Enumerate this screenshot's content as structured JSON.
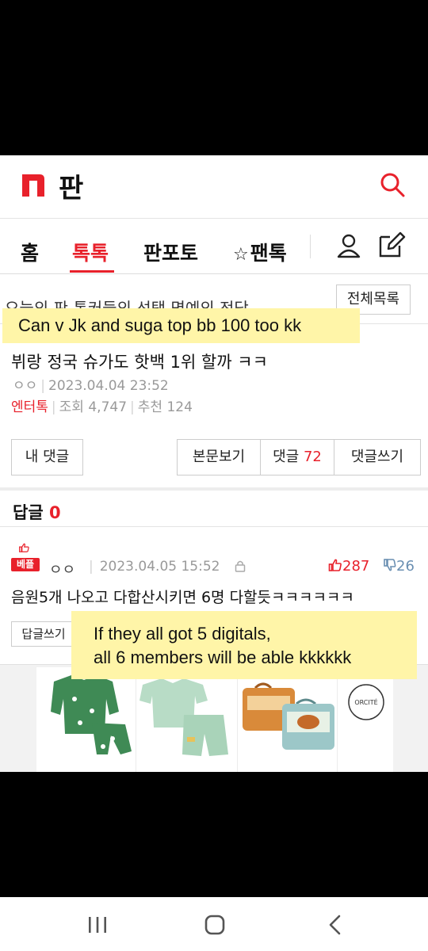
{
  "header": {
    "logo_text": "판",
    "brand_color": "#e8212b"
  },
  "tabs": [
    {
      "label": "홈",
      "active": false
    },
    {
      "label": "톡톡",
      "active": true
    },
    {
      "label": "판포토",
      "active": false
    },
    {
      "label": "팬톡",
      "active": false,
      "prefix": "☆"
    }
  ],
  "ticker": {
    "text": "오늘의 판 톡커들의 선택 명예의 전당",
    "all_list_label": "전체목록"
  },
  "overlay_top": "Can v Jk and suga top bb 100 too kk",
  "article": {
    "title": "뷔랑 정국 슈가도 핫백 1위 할까 ㅋㅋ",
    "author": "ㅇㅇ",
    "datetime": "2023.04.04 23:52",
    "category": "엔터톡",
    "views_label": "조회",
    "views": "4,747",
    "recommend_label": "추천",
    "recommend": "124"
  },
  "buttons": {
    "my_comment": "내 댓글",
    "view_body": "본문보기",
    "comments_label": "댓글",
    "comments_count": "72",
    "write_comment": "댓글쓰기"
  },
  "replies": {
    "label": "답글",
    "count": "0"
  },
  "comment": {
    "badge": "베플",
    "author": "ㅇㅇ",
    "datetime": "2023.04.05 15:52",
    "likes": "287",
    "dislikes": "26",
    "body": "음원5개 나오고 다합산시키면 6명 다할듯ㅋㅋㅋㅋㅋㅋ",
    "reply_button": "답글쓰기"
  },
  "overlay_bottom": {
    "line1": "If they all got 5 digitals,",
    "line2": "all 6 members will be able kkkkkk"
  },
  "ads": [
    {
      "name": "green-pajama-set",
      "color": "#3f8a55"
    },
    {
      "name": "mint-shortsleeve-pajama",
      "color": "#a9d3b9"
    },
    {
      "name": "tin-suitcases",
      "color": "#d98a3a"
    },
    {
      "name": "orcite-logo",
      "text": "ORCITÉ"
    }
  ],
  "icons": [
    "search-icon",
    "user-icon",
    "write-icon",
    "lock-icon",
    "thumbs-up-icon",
    "thumbs-down-icon"
  ]
}
